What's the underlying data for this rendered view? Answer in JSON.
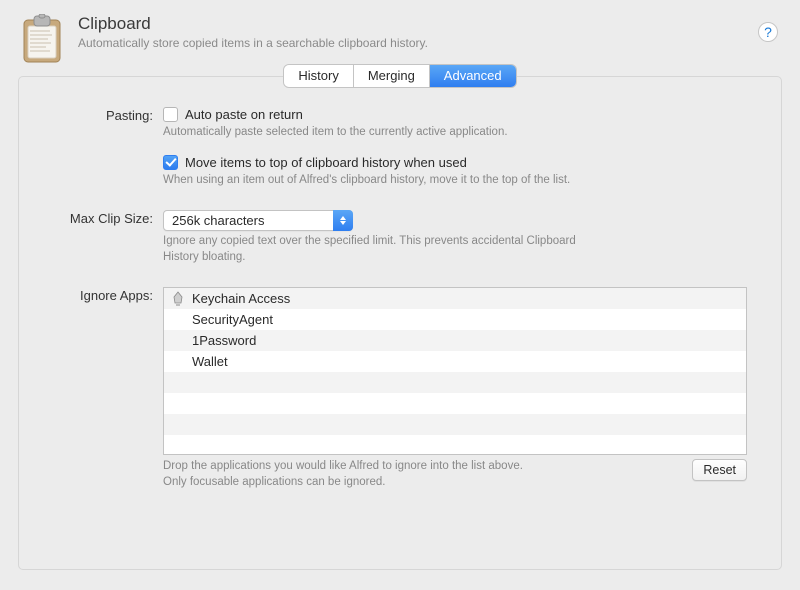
{
  "header": {
    "title": "Clipboard",
    "subtitle": "Automatically store copied items in a searchable clipboard history."
  },
  "help": {
    "symbol": "?"
  },
  "tabs": [
    {
      "label": "History",
      "active": false
    },
    {
      "label": "Merging",
      "active": false
    },
    {
      "label": "Advanced",
      "active": true
    }
  ],
  "pasting": {
    "label": "Pasting:",
    "auto_paste": {
      "checked": false,
      "text": "Auto paste on return"
    },
    "auto_paste_hint": "Automatically paste selected item to the currently active application.",
    "move_top": {
      "checked": true,
      "text": "Move items to top of clipboard history when used"
    },
    "move_top_hint": "When using an item out of Alfred's clipboard history, move it to the top of the list."
  },
  "max_clip": {
    "label": "Max Clip Size:",
    "value": "256k characters",
    "hint": "Ignore any copied text over the specified limit. This prevents accidental Clipboard History bloating."
  },
  "ignore": {
    "label": "Ignore Apps:",
    "apps": [
      {
        "name": "Keychain Access",
        "icon": "keychain-icon"
      },
      {
        "name": "SecurityAgent",
        "icon": ""
      },
      {
        "name": "1Password",
        "icon": ""
      },
      {
        "name": "Wallet",
        "icon": ""
      }
    ],
    "hint": "Drop the applications you would like Alfred to ignore into the list above.\nOnly focusable applications can be ignored.",
    "reset_label": "Reset"
  }
}
